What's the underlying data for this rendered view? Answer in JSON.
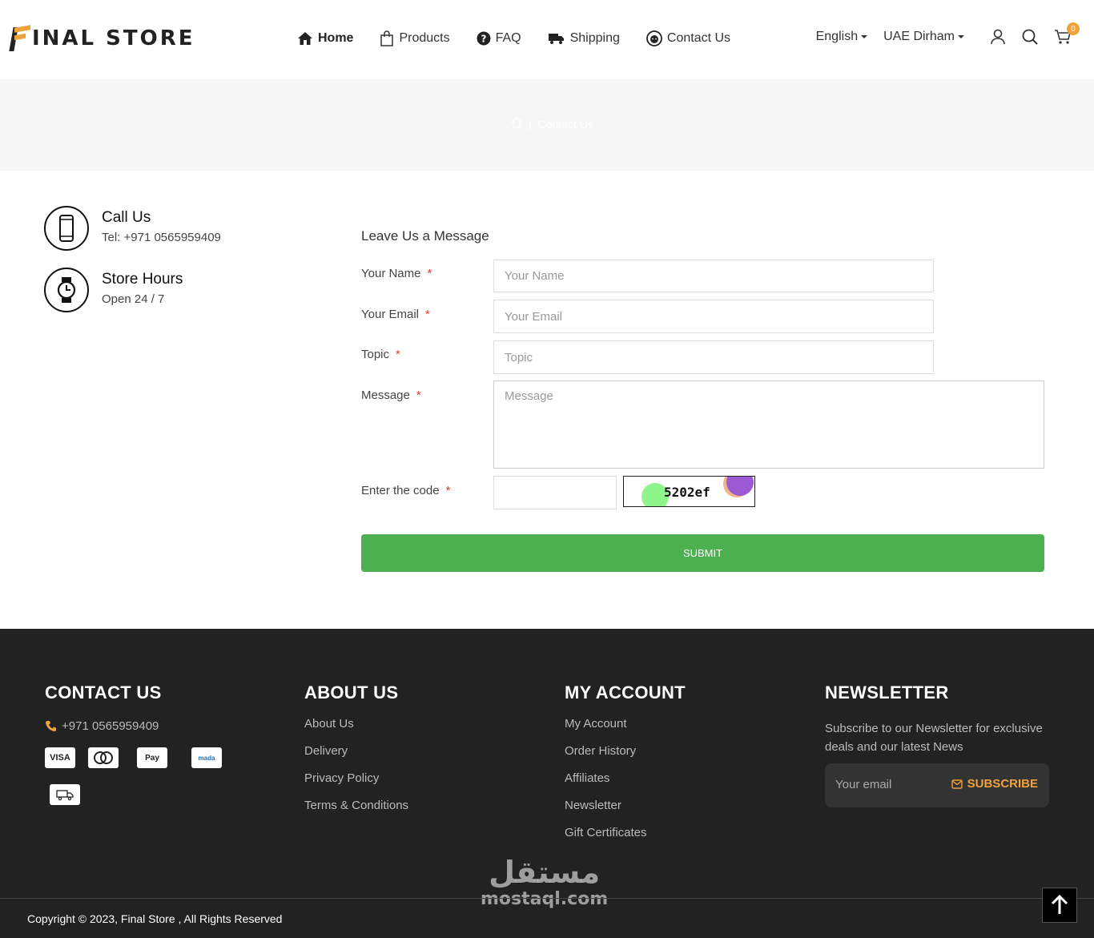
{
  "header": {
    "logo_text": "INAL STORE",
    "nav": [
      {
        "label": "Home",
        "icon": "home-icon"
      },
      {
        "label": "Products",
        "icon": "bag-icon"
      },
      {
        "label": "FAQ",
        "icon": "question-icon"
      },
      {
        "label": "Shipping",
        "icon": "truck-icon"
      },
      {
        "label": "Contact Us",
        "icon": "support-icon"
      }
    ],
    "language": "English",
    "currency": "UAE Dirham",
    "cart_count": "0",
    "accent": "#f0a23b"
  },
  "breadcrumb": {
    "current": "Contact Us"
  },
  "contact_info": {
    "call_title": "Call Us",
    "call_sub": "Tel: +971 0565959409",
    "hours_title": "Store Hours",
    "hours_sub": "Open 24 / 7"
  },
  "form": {
    "title": "Leave Us a Message",
    "name_label": "Your Name",
    "name_placeholder": "Your Name",
    "email_label": "Your Email",
    "email_placeholder": "Your Email",
    "topic_label": "Topic",
    "topic_placeholder": "Topic",
    "message_label": "Message",
    "message_placeholder": "Message",
    "code_label": "Enter the code",
    "captcha_code": "5202ef",
    "required_mark": "*",
    "submit_label": "SUBMIT",
    "submit_color": "#4caf50"
  },
  "footer": {
    "contact_head": "CONTACT US",
    "phone": "+971 0565959409",
    "payments": [
      "VISA",
      "mastercard",
      "Apple Pay",
      "mada",
      "delivery"
    ],
    "about_head": "ABOUT US",
    "about_links": [
      "About Us",
      "Delivery",
      "Privacy Policy",
      "Terms & Conditions"
    ],
    "account_head": "MY ACCOUNT",
    "account_links": [
      "My Account",
      "Order History",
      "Affiliates",
      "Newsletter",
      "Gift Certificates"
    ],
    "news_head": "NEWSLETTER",
    "news_text": "Subscribe to our Newsletter for exclusive deals and our latest News",
    "news_placeholder": "Your email",
    "subscribe_label": "SUBSCRIBE",
    "copyright": "Copyright © 2023, Final Store , All Rights Reserved",
    "watermark_ar": "مستقل",
    "watermark_lat": "mostaql.com"
  }
}
